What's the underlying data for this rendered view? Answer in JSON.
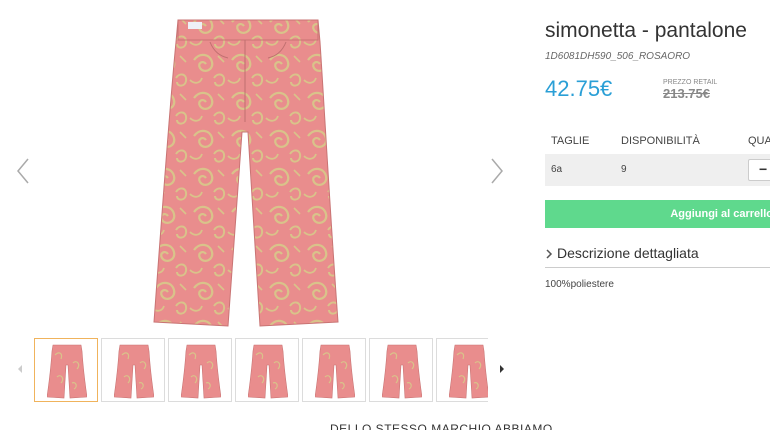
{
  "product": {
    "title": "simonetta - pantalone",
    "code": "1D6081DH590_506_ROSAORO",
    "price": "42.75€",
    "retail_label": "PREZZO RETAIL",
    "retail_price": "213.75€"
  },
  "availability_table": {
    "headers": [
      "TAGLIE",
      "DISPONIBILITÀ",
      "QUA"
    ],
    "rows": [
      {
        "size": "6a",
        "availability": "9",
        "qty_control": "−"
      }
    ]
  },
  "cart": {
    "label": "Aggiungi al carrello"
  },
  "description": {
    "title": "Descrizione dettagliata",
    "text": "100%poliestere"
  },
  "gallery": {
    "thumbnail_count": 7,
    "active_thumbnail": 0,
    "icons": {
      "prev": "chevron-left-icon",
      "next": "chevron-right-icon",
      "thumb_prev": "caret-left-icon",
      "thumb_next": "caret-right-icon",
      "description_toggle": "chevron-right-icon"
    }
  },
  "footer": {
    "heading": "DELLO STESSO MARCHIO ABBIAMO"
  },
  "colors": {
    "price": "#2a9fd6",
    "cart_button": "#5fd98d",
    "active_thumb_border": "#f0b35c",
    "fabric_pink": "#e98d8d",
    "fabric_gold": "#d9c38a"
  }
}
